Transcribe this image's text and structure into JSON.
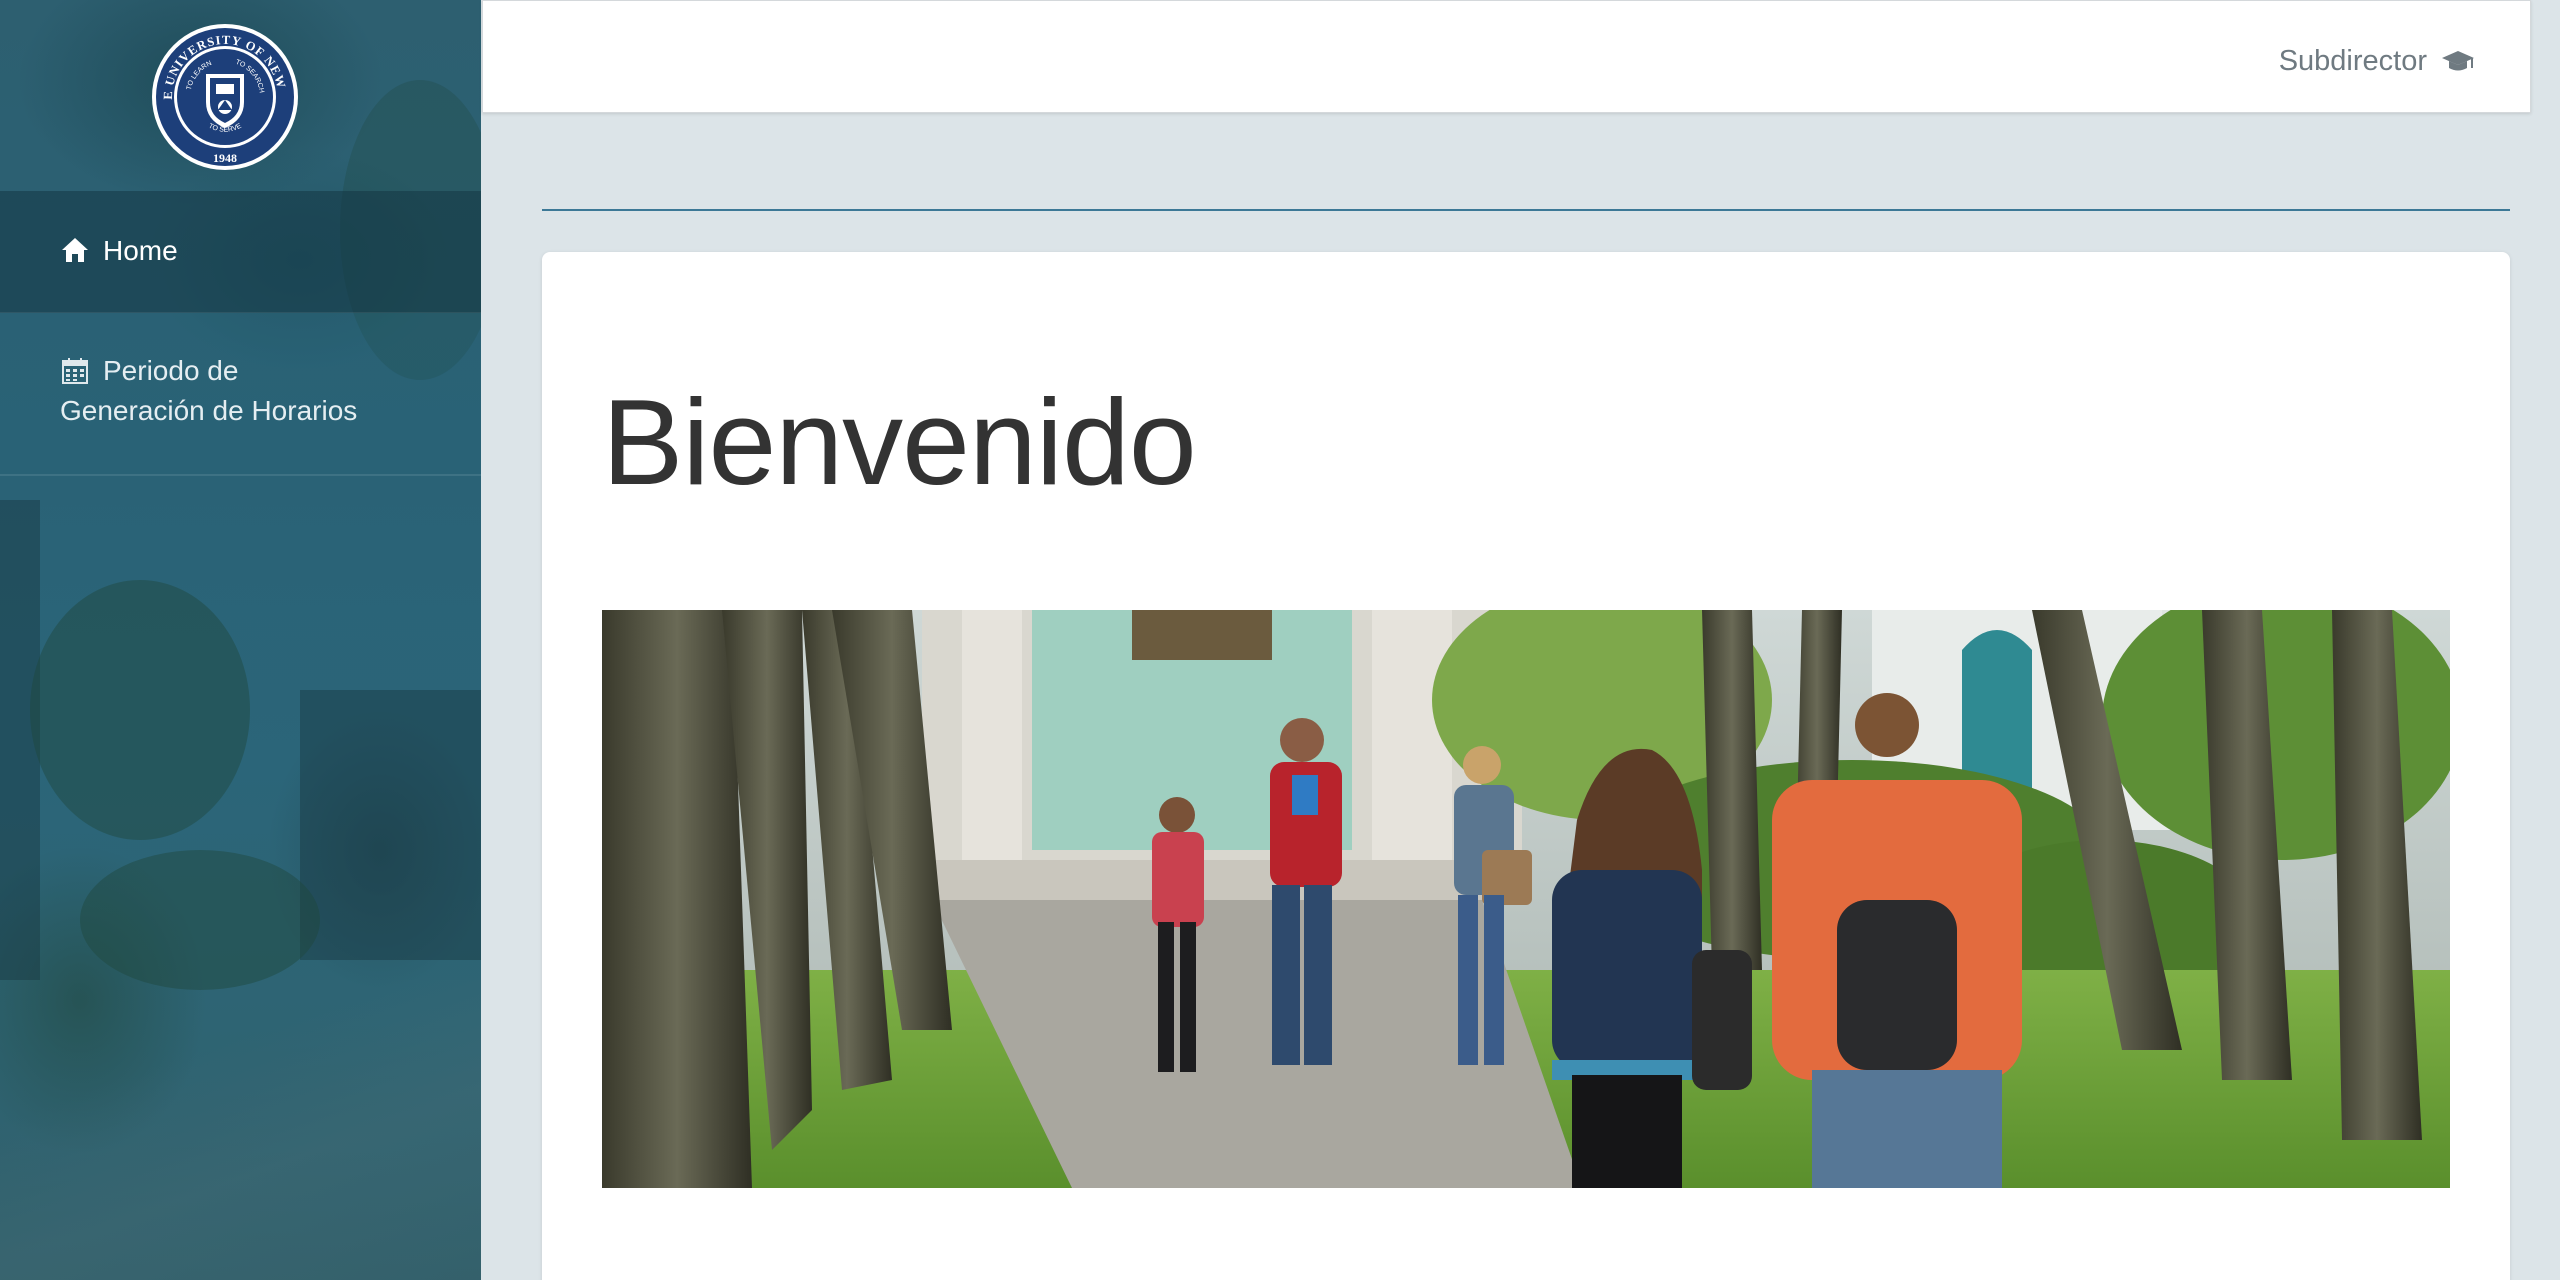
{
  "sidebar": {
    "logo": {
      "arc_top": "STATE UNIVERSITY OF NEW YORK",
      "motto_left": "TO LEARN",
      "motto_right": "TO SEARCH",
      "motto_bottom": "TO SERVE",
      "year": "1948"
    },
    "items": [
      {
        "label": "Home",
        "icon": "home-icon",
        "active": true
      },
      {
        "label_line1": "Periodo de",
        "label_line2": "Generación de Horarios",
        "icon": "calendar-icon",
        "active": false
      }
    ]
  },
  "header": {
    "user_role": "Subdirector",
    "user_icon": "graduation-cap-icon"
  },
  "main": {
    "title": "Bienvenido",
    "hero_image": "students-walking-campus-photo"
  },
  "colors": {
    "sidebar": "#2b6579",
    "page_bg": "#dce4e8",
    "divider": "#3c7896",
    "title": "#333333",
    "user_text": "#6f7a81"
  }
}
